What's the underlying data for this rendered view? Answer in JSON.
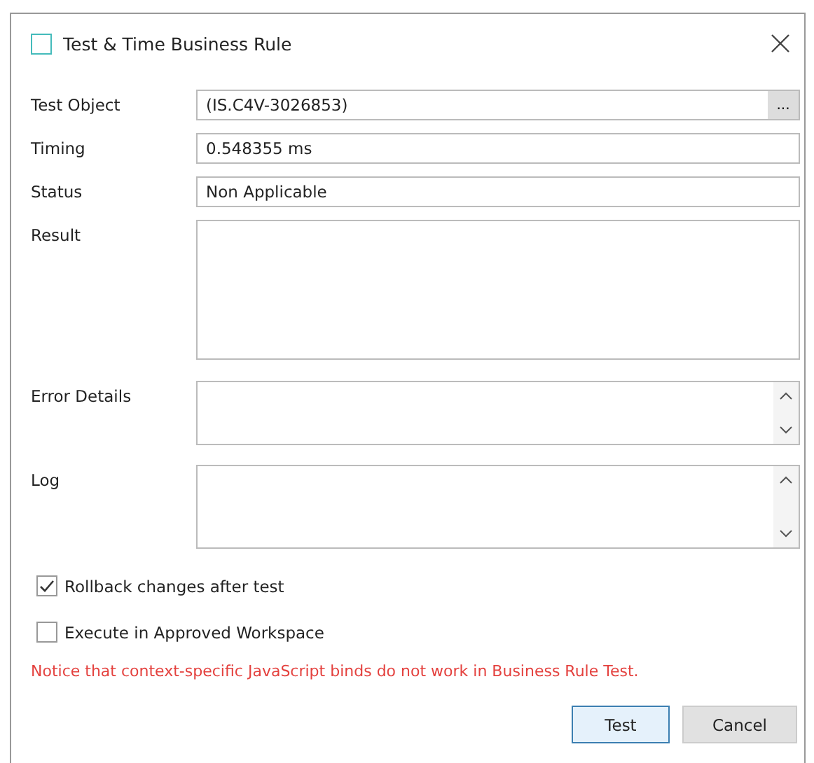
{
  "window": {
    "title": "Test & Time Business Rule"
  },
  "fields": [
    {
      "label": "Test Object",
      "kind": "picker",
      "value": "(IS.C4V-3026853)",
      "button": "..."
    },
    {
      "label": "Timing",
      "kind": "text",
      "value": "0.548355 ms"
    },
    {
      "label": "Status",
      "kind": "text",
      "value": "Non Applicable"
    },
    {
      "label": "Result",
      "kind": "area"
    },
    {
      "label": "Error Details",
      "kind": "scroll"
    },
    {
      "label": "Log",
      "kind": "scroll"
    }
  ],
  "options": [
    {
      "label": "Rollback changes after test",
      "checked": true
    },
    {
      "label": "Execute in Approved Workspace",
      "checked": false
    }
  ],
  "notice": "Notice that context-specific JavaScript binds do not work in Business Rule Test.",
  "buttons": [
    {
      "label": "Test",
      "selected": true
    },
    {
      "label": "Cancel",
      "selected": false
    }
  ]
}
